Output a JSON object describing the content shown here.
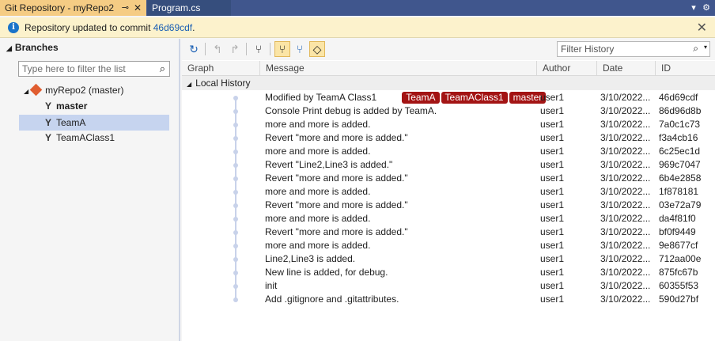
{
  "tabs": {
    "active": {
      "title": "Git Repository - myRepo2",
      "pin": "⊸",
      "close": "✕"
    },
    "inactive": {
      "title": "Program.cs"
    },
    "dropdown_glyph": "▾",
    "settings_glyph": "⚙"
  },
  "infobar": {
    "icon": "i",
    "text": "Repository updated to commit ",
    "commit_link": "46d69cdf",
    "suffix": ".",
    "close": "✕"
  },
  "branches": {
    "header": "Branches",
    "filter_placeholder": "Type here to filter the list",
    "repo": {
      "label": "myRepo2 (master)"
    },
    "items": [
      {
        "label": "master",
        "bold": true
      },
      {
        "label": "TeamA",
        "selected": true
      },
      {
        "label": "TeamAClass1"
      }
    ]
  },
  "toolbar": {
    "filter_placeholder": "Filter History"
  },
  "columns": {
    "graph": "Graph",
    "message": "Message",
    "author": "Author",
    "date": "Date",
    "id": "ID"
  },
  "history": {
    "group_label": "Local History",
    "commits": [
      {
        "message": "Modified by TeamA Class1",
        "tags": [
          "TeamA",
          "TeamAClass1",
          "master"
        ],
        "author": "user1",
        "date": "3/10/2022...",
        "id": "46d69cdf"
      },
      {
        "message": "Console Print debug is added by TeamA.",
        "tags": [],
        "author": "user1",
        "date": "3/10/2022...",
        "id": "86d96d8b"
      },
      {
        "message": "more and more is added.",
        "tags": [],
        "author": "user1",
        "date": "3/10/2022...",
        "id": "7a0c1c73"
      },
      {
        "message": "Revert \"more and more is added.\"",
        "tags": [],
        "author": "user1",
        "date": "3/10/2022...",
        "id": "f3a4cb16"
      },
      {
        "message": "more and more is added.",
        "tags": [],
        "author": "user1",
        "date": "3/10/2022...",
        "id": "6c25ec1d"
      },
      {
        "message": "Revert \"Line2,Line3 is added.\"",
        "tags": [],
        "author": "user1",
        "date": "3/10/2022...",
        "id": "969c7047"
      },
      {
        "message": "Revert \"more and more is added.\"",
        "tags": [],
        "author": "user1",
        "date": "3/10/2022...",
        "id": "6b4e2858"
      },
      {
        "message": "more and more is added.",
        "tags": [],
        "author": "user1",
        "date": "3/10/2022...",
        "id": "1f878181"
      },
      {
        "message": "Revert \"more and more is added.\"",
        "tags": [],
        "author": "user1",
        "date": "3/10/2022...",
        "id": "03e72a79"
      },
      {
        "message": "more and more is added.",
        "tags": [],
        "author": "user1",
        "date": "3/10/2022...",
        "id": "da4f81f0"
      },
      {
        "message": "Revert \"more and more is added.\"",
        "tags": [],
        "author": "user1",
        "date": "3/10/2022...",
        "id": "bf0f9449"
      },
      {
        "message": "more and more is added.",
        "tags": [],
        "author": "user1",
        "date": "3/10/2022...",
        "id": "9e8677cf"
      },
      {
        "message": "Line2,Line3 is added.",
        "tags": [],
        "author": "user1",
        "date": "3/10/2022...",
        "id": "712aa00e"
      },
      {
        "message": "New line is added, for debug.",
        "tags": [],
        "author": "user1",
        "date": "3/10/2022...",
        "id": "875fc67b"
      },
      {
        "message": "init",
        "tags": [],
        "author": "user1",
        "date": "3/10/2022...",
        "id": "60355f53"
      },
      {
        "message": "Add .gitignore and .gitattributes.",
        "tags": [],
        "author": "user1",
        "date": "3/10/2022...",
        "id": "590d27bf"
      }
    ]
  },
  "colors": {
    "tab_strip": "#40568d",
    "active_tab": "#f5cc84",
    "tag_background": "#a31414",
    "graph_line": "#c8d2ea",
    "selection": "#c6d4ef",
    "infobar": "#fcf2cc"
  }
}
